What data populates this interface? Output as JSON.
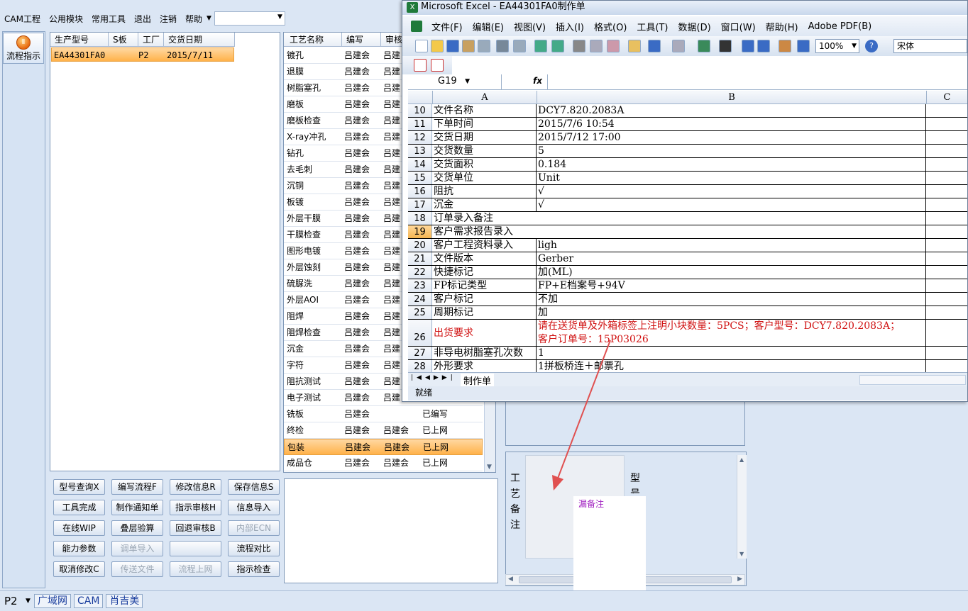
{
  "menu": {
    "items": [
      "CAM工程",
      "公用模块",
      "常用工具",
      "退出",
      "注销",
      "帮助"
    ],
    "combo_value": ""
  },
  "flow_button": {
    "label": "流程指示"
  },
  "prod_table": {
    "headers": [
      "生产型号",
      "S板",
      "工厂",
      "交货日期"
    ],
    "row": {
      "model": "EA44301FA0",
      "s": "",
      "factory": "P2",
      "date": "2015/7/11"
    }
  },
  "proc_table": {
    "headers": [
      "工艺名称",
      "编写",
      "审核"
    ],
    "rows": [
      [
        "镀孔",
        "吕建会",
        "吕建",
        ""
      ],
      [
        "退膜",
        "吕建会",
        "吕建",
        ""
      ],
      [
        "树脂塞孔",
        "吕建会",
        "吕建",
        ""
      ],
      [
        "磨板",
        "吕建会",
        "吕建",
        ""
      ],
      [
        "磨板检查",
        "吕建会",
        "吕建",
        ""
      ],
      [
        "X-ray冲孔",
        "吕建会",
        "吕建",
        ""
      ],
      [
        "钻孔",
        "吕建会",
        "吕建",
        ""
      ],
      [
        "去毛刺",
        "吕建会",
        "吕建",
        ""
      ],
      [
        "沉铜",
        "吕建会",
        "吕建",
        ""
      ],
      [
        "板镀",
        "吕建会",
        "吕建",
        ""
      ],
      [
        "外层干膜",
        "吕建会",
        "吕建",
        ""
      ],
      [
        "干膜检查",
        "吕建会",
        "吕建",
        ""
      ],
      [
        "图形电镀",
        "吕建会",
        "吕建",
        ""
      ],
      [
        "外层蚀刻",
        "吕建会",
        "吕建",
        ""
      ],
      [
        "硫脲洗",
        "吕建会",
        "吕建",
        ""
      ],
      [
        "外层AOI",
        "吕建会",
        "吕建",
        ""
      ],
      [
        "阻焊",
        "吕建会",
        "吕建",
        ""
      ],
      [
        "阻焊检查",
        "吕建会",
        "吕建",
        ""
      ],
      [
        "沉金",
        "吕建会",
        "吕建",
        ""
      ],
      [
        "字符",
        "吕建会",
        "吕建",
        ""
      ],
      [
        "阻抗测试",
        "吕建会",
        "吕建",
        ""
      ],
      [
        "电子测试",
        "吕建会",
        "吕建",
        ""
      ],
      [
        "铣板",
        "吕建会",
        "",
        "已编写"
      ],
      [
        "终检",
        "吕建会",
        "吕建会",
        "已上网"
      ],
      [
        "包装",
        "吕建会",
        "吕建会",
        "已上网"
      ],
      [
        "成品仓",
        "吕建会",
        "吕建会",
        "已上网"
      ]
    ]
  },
  "buttons": {
    "row1": [
      "型号查询X",
      "编写流程F",
      "修改信息R",
      "保存信息S"
    ],
    "row2": [
      "工具完成",
      "制作通知单",
      "指示审核H",
      "信息导入"
    ],
    "row3": [
      "在线WIP",
      "叠层验算",
      "回退审核B",
      "内部ECN"
    ],
    "row4": [
      "能力参数",
      "调单导入",
      "",
      "流程对比"
    ],
    "row5": [
      "取消修改C",
      "传送文件",
      "流程上网",
      "指示检查"
    ]
  },
  "remark": {
    "vertical_label": [
      "工",
      "艺",
      "备",
      "注"
    ],
    "model_label": [
      "型",
      "号"
    ],
    "popup_text": "漏备注"
  },
  "statusbar": {
    "factory": "P2",
    "net": "广域网",
    "dept": "CAM",
    "user": "肖吉美"
  },
  "excel": {
    "title": "Microsoft Excel - EA44301FA0制作单",
    "menu": [
      "文件(F)",
      "编辑(E)",
      "视图(V)",
      "插入(I)",
      "格式(O)",
      "工具(T)",
      "数据(D)",
      "窗口(W)",
      "帮助(H)",
      "Adobe PDF(B)"
    ],
    "zoom": "100%",
    "font": "宋体",
    "name_box": "G19",
    "fx": "fx",
    "columns": [
      "A",
      "B",
      "C"
    ],
    "rows": [
      {
        "n": "10",
        "a": "文件名称",
        "b": "DCY7.820.2083A"
      },
      {
        "n": "11",
        "a": "下单时间",
        "b": "2015/7/6 10:54"
      },
      {
        "n": "12",
        "a": "交货日期",
        "b": "2015/7/12 17:00"
      },
      {
        "n": "13",
        "a": "交货数量",
        "b": "5"
      },
      {
        "n": "14",
        "a": "交货面积",
        "b": "0.184"
      },
      {
        "n": "15",
        "a": "交货单位",
        "b": "Unit"
      },
      {
        "n": "16",
        "a": "阻抗",
        "b": "√"
      },
      {
        "n": "17",
        "a": "沉金",
        "b": "√"
      },
      {
        "n": "18",
        "a": "订单录入备注",
        "b": ""
      },
      {
        "n": "19",
        "a": "客户需求报告录入",
        "b": ""
      },
      {
        "n": "20",
        "a": "客户工程资料录入",
        "b": "ligh"
      },
      {
        "n": "21",
        "a": "文件版本",
        "b": "Gerber"
      },
      {
        "n": "22",
        "a": "快捷标记",
        "b": "加(ML)"
      },
      {
        "n": "23",
        "a": "FP标记类型",
        "b": "FP+E档案号+94V"
      },
      {
        "n": "24",
        "a": "客户标记",
        "b": "不加"
      },
      {
        "n": "25",
        "a": "周期标记",
        "b": "加"
      },
      {
        "n": "26",
        "a": "出货要求",
        "b": "请在送货单及外箱标签上注明小块数量：5PCS；客户型号：DCY7.820.2083A；",
        "b2": "客户订单号：15P03026"
      },
      {
        "n": "27",
        "a": "非导电树脂塞孔次数",
        "b": "1"
      },
      {
        "n": "28",
        "a": "外形要求",
        "b": "1拼板桥连＋邮票孔"
      }
    ],
    "sheet_tab": "制作单",
    "status": "就绪",
    "accent_red": "#d01010"
  }
}
